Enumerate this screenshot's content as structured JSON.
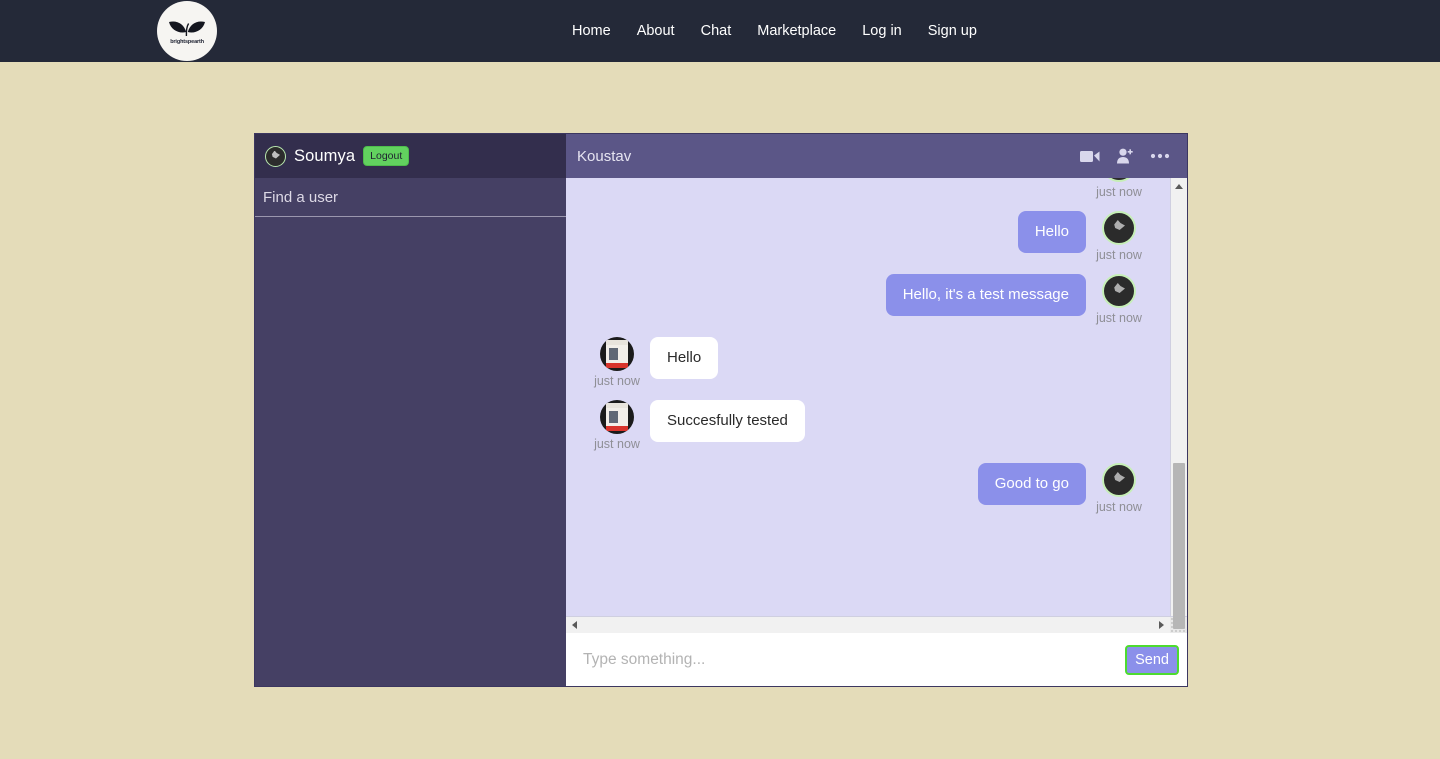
{
  "navbar": {
    "brand": {
      "name": "brightspearth-logo",
      "text": "brightspearth"
    },
    "links": [
      {
        "label": "Home"
      },
      {
        "label": "About"
      },
      {
        "label": "Chat"
      },
      {
        "label": "Marketplace"
      },
      {
        "label": "Log in"
      },
      {
        "label": "Sign up"
      }
    ]
  },
  "colors": {
    "page_background": "#e4dcb9",
    "navbar_background": "#242938",
    "sidebar_background": "#454064",
    "sidebar_header_background": "#332e4d",
    "chat_header_background": "#5b5687",
    "messages_background": "#dbd9f5",
    "outgoing_bubble": "#8b90ea",
    "incoming_bubble": "#ffffff",
    "logout_green": "#62d25f",
    "send_focus_green": "#4ddb2f"
  },
  "sidebar": {
    "current_user": "Soumya",
    "logout_label": "Logout",
    "search_placeholder": "Find a user",
    "search_value": "",
    "conversations": []
  },
  "chat": {
    "peer_name": "Koustav",
    "actions": [
      {
        "name": "video-call-icon",
        "label": "Video call"
      },
      {
        "name": "add-person-icon",
        "label": "Add person"
      },
      {
        "name": "more-options-icon",
        "label": "More options"
      }
    ],
    "messages": [
      {
        "direction": "out",
        "text": "",
        "time": "just now",
        "partial": true,
        "avatar": "leaf"
      },
      {
        "direction": "out",
        "text": "Hello",
        "time": "just now",
        "partial": false,
        "avatar": "leaf"
      },
      {
        "direction": "out",
        "text": "Hello, it's a test message",
        "time": "just now",
        "partial": false,
        "avatar": "leaf"
      },
      {
        "direction": "in",
        "text": "Hello",
        "time": "just now",
        "partial": false,
        "avatar": "photo"
      },
      {
        "direction": "in",
        "text": "Succesfully tested",
        "time": "just now",
        "partial": false,
        "avatar": "photo"
      },
      {
        "direction": "out",
        "text": "Good to go",
        "time": "just now",
        "partial": false,
        "avatar": "leaf"
      }
    ],
    "composer": {
      "placeholder": "Type something...",
      "value": "",
      "send_label": "Send"
    }
  }
}
